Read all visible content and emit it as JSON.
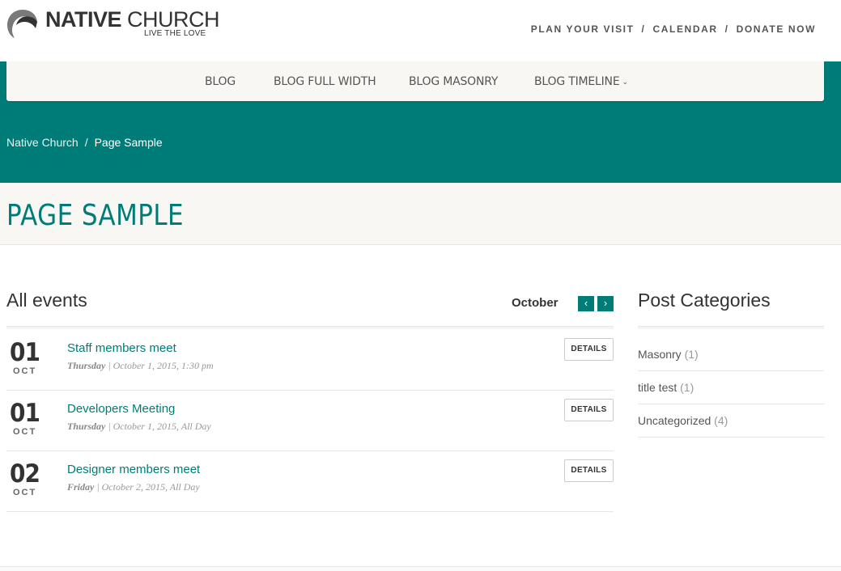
{
  "header": {
    "logo_bold": "NATIVE",
    "logo_thin": "CHURCH",
    "tagline": "LIVE THE LOVE",
    "top_links": [
      "PLAN YOUR VISIT",
      "CALENDAR",
      "DONATE NOW"
    ],
    "separator": "/"
  },
  "nav": {
    "items": [
      "BLOG",
      "BLOG FULL WIDTH",
      "BLOG MASONRY",
      "BLOG TIMELINE"
    ],
    "dropdown_chevron": "⌄"
  },
  "breadcrumb": {
    "home": "Native Church",
    "separator": "/",
    "current": "Page Sample"
  },
  "page": {
    "title": "PAGE SAMPLE"
  },
  "events": {
    "heading": "All events",
    "month": "October",
    "prev_icon": "‹",
    "next_icon": "›",
    "details_label": "DETAILS",
    "items": [
      {
        "day": "01",
        "month": "OCT",
        "title": "Staff members meet",
        "weekday": "Thursday",
        "when": " | October 1, 2015,  1:30 pm"
      },
      {
        "day": "01",
        "month": "OCT",
        "title": "Developers Meeting",
        "weekday": "Thursday",
        "when": " | October 1, 2015,  All Day"
      },
      {
        "day": "02",
        "month": "OCT",
        "title": "Designer members meet",
        "weekday": "Friday",
        "when": " | October 2, 2015,  All Day"
      }
    ]
  },
  "sidebar": {
    "heading": "Post Categories",
    "categories": [
      {
        "name": "Masonry",
        "count": "(1)"
      },
      {
        "name": "title test",
        "count": "(1)"
      },
      {
        "name": "Uncategorized",
        "count": "(4)"
      }
    ]
  },
  "colors": {
    "accent": "#007c78",
    "band": "#f8f7f3"
  }
}
